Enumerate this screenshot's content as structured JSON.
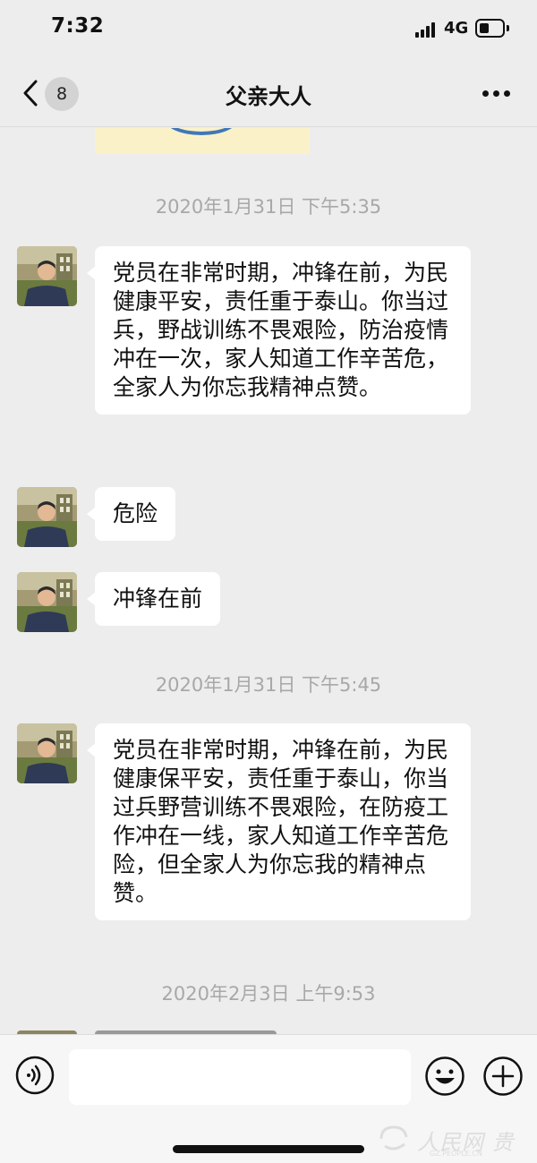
{
  "status_bar": {
    "time": "7:32",
    "network": "4G"
  },
  "nav": {
    "unread_count": "8",
    "title": "父亲大人"
  },
  "messages": [
    {
      "timestamp": "2020年1月31日 下午5:35"
    },
    {
      "text": "党员在非常时期，冲锋在前，为民健康平安，责任重于泰山。你当过兵，野战训练不畏艰险，防治疫情冲在一次，家人知道工作辛苦危，全家人为你忘我精神点赞。"
    },
    {
      "text": "危险"
    },
    {
      "text": "冲锋在前"
    },
    {
      "timestamp": "2020年1月31日 下午5:45"
    },
    {
      "text": "党员在非常时期，冲锋在前，为民健康保平安，责任重于泰山，你当过兵野营训练不畏艰险，在防疫工作冲在一线，家人知道工作辛苦危险，但全家人为你忘我的精神点赞。"
    },
    {
      "timestamp": "2020年2月3日 上午9:53"
    }
  ],
  "input": {
    "placeholder": ""
  },
  "watermark": {
    "text": "人民网 贵州",
    "sub": "GZ.PEOPLE.CN"
  },
  "colors": {
    "background": "#ededed",
    "bubble": "#ffffff",
    "timestamp": "#a8a8a8",
    "input_bar": "#f6f6f6"
  },
  "icons": [
    "back-chevron-icon",
    "more-dots-icon",
    "voice-icon",
    "emoji-icon",
    "plus-icon",
    "signal-icon",
    "battery-icon"
  ]
}
